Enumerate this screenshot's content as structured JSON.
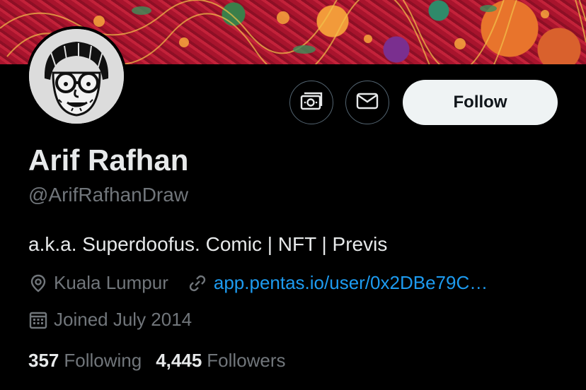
{
  "profile": {
    "name": "Arif Rafhan",
    "handle": "@ArifRafhanDraw",
    "bio": "a.k.a. Superdoofus. Comic | NFT | Previs",
    "location": "Kuala Lumpur",
    "website": "app.pentas.io/user/0x2DBe79C…",
    "joined": "Joined July 2014"
  },
  "actions": {
    "follow_label": "Follow",
    "tip_icon": "money-icon",
    "message_icon": "mail-icon"
  },
  "stats": {
    "following_count": "357",
    "following_label": "Following",
    "followers_count": "4,445",
    "followers_label": "Followers"
  },
  "colors": {
    "background": "#000000",
    "accent_link": "#1d9bf0",
    "muted_text": "#71767b",
    "follow_button_bg": "#eff3f4"
  }
}
